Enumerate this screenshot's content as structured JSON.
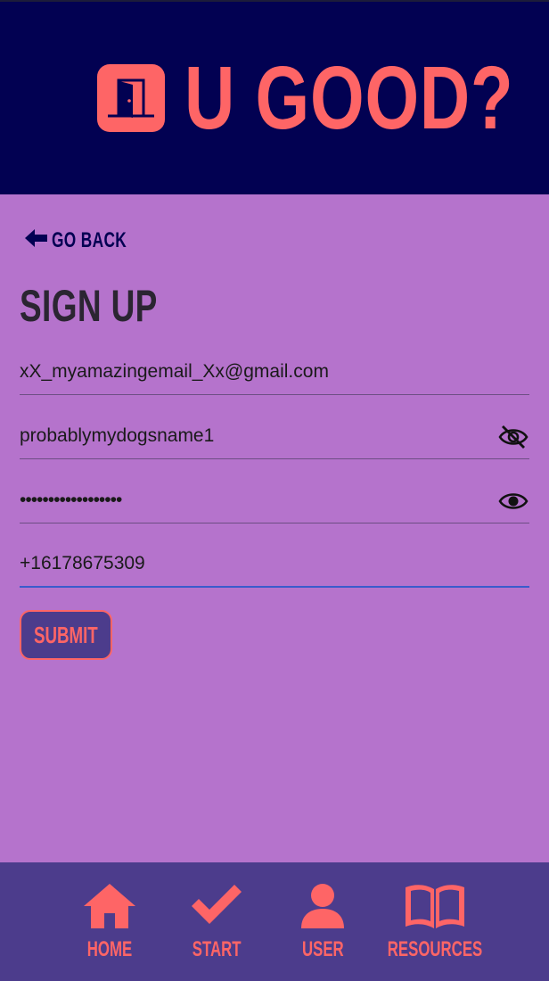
{
  "app": {
    "title": "U GOOD?",
    "logo_icon": "door-icon",
    "colors": {
      "header_bg": "#020152",
      "page_bg": "#b573cc",
      "accent": "#fe6566",
      "nav_bg": "#4c3c8c",
      "active_underline": "#3a5bcc"
    }
  },
  "nav_back": {
    "label": "GO BACK",
    "icon": "arrow-left-icon"
  },
  "form": {
    "title": "SIGN UP",
    "email": {
      "value": "xX_myamazingemail_Xx@gmail.com"
    },
    "password": {
      "value": "probablymydogsname1",
      "toggle_icon": "eye-slash-icon"
    },
    "confirm_password": {
      "value": "••••••••••••••••••",
      "toggle_icon": "eye-icon"
    },
    "phone": {
      "value": "+16178675309"
    },
    "submit_label": "SUBMIT"
  },
  "bottom_nav": {
    "items": [
      {
        "label": "HOME",
        "icon": "home-icon"
      },
      {
        "label": "START",
        "icon": "checkmark-icon"
      },
      {
        "label": "USER",
        "icon": "user-icon"
      },
      {
        "label": "RESOURCES",
        "icon": "book-icon"
      }
    ]
  }
}
